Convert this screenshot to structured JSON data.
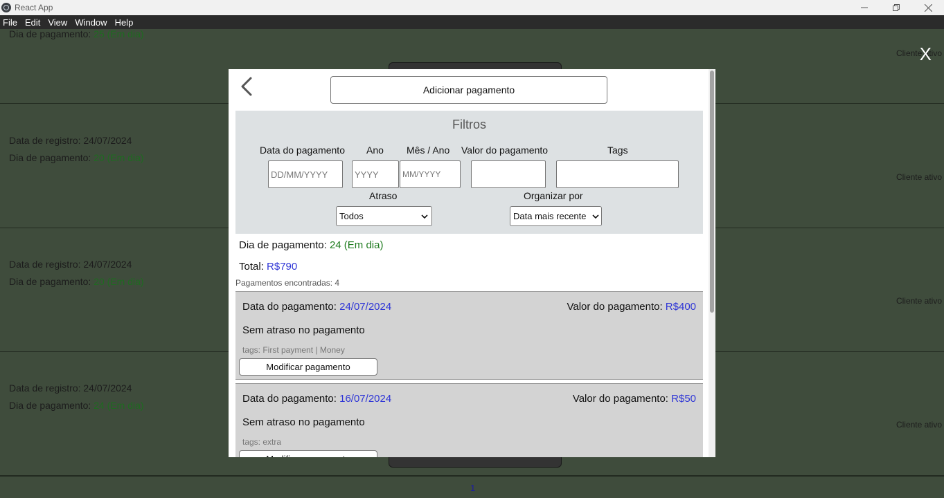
{
  "window": {
    "title": "React App"
  },
  "menu": [
    "File",
    "Edit",
    "View",
    "Window",
    "Help"
  ],
  "background_rows": [
    {
      "registration_label": "",
      "registration_value": "",
      "payment_day_label": "Dia de pagamento:",
      "payment_day_value": "25 (Em dia)",
      "status": "Cliente ativo"
    },
    {
      "registration_label": "Data de registro:",
      "registration_value": "24/07/2024",
      "payment_day_label": "Dia de pagamento:",
      "payment_day_value": "20 (Em dia)",
      "status": "Cliente ativo"
    },
    {
      "registration_label": "Data de registro:",
      "registration_value": "24/07/2024",
      "payment_day_label": "Dia de pagamento:",
      "payment_day_value": "20 (Em dia)",
      "status": "Cliente ativo"
    },
    {
      "registration_label": "Data de registro:",
      "registration_value": "24/07/2024",
      "payment_day_label": "Dia de pagamento:",
      "payment_day_value": "24 (Em dia)",
      "status": "Cliente ativo"
    }
  ],
  "close_label": "X",
  "pagination": {
    "current_page": "1"
  },
  "modal": {
    "add_button_label": "Adicionar pagamento",
    "filters": {
      "title": "Filtros",
      "payment_date_label": "Data do pagamento",
      "payment_date_placeholder": "DD/MM/YYYY",
      "year_label": "Ano",
      "year_placeholder": "YYYY",
      "month_year_label": "Mês / Ano",
      "month_year_placeholder": "MM/YYYY",
      "value_label": "Valor do pagamento",
      "value_value": "",
      "tags_label": "Tags",
      "tags_value": "",
      "delay_label": "Atraso",
      "delay_selected": "Todos",
      "sort_label": "Organizar por",
      "sort_selected": "Data mais recente"
    },
    "summary": {
      "payment_day_label": "Dia de pagamento:",
      "payment_day_value": "24 (Em dia)",
      "total_label": "Total:",
      "total_value": "R$790",
      "found_text": "Pagamentos encontradas: 4"
    },
    "payments": [
      {
        "date_label": "Data do pagamento:",
        "date_value": "24/07/2024",
        "value_label": "Valor do pagamento:",
        "value_value": "R$400",
        "delay_text": "Sem atraso no pagamento",
        "tags_text": "tags: First payment | Money",
        "modify_label": "Modificar pagamento"
      },
      {
        "date_label": "Data do pagamento:",
        "date_value": "16/07/2024",
        "value_label": "Valor do pagamento:",
        "value_value": "R$50",
        "delay_text": "Sem atraso no pagamento",
        "tags_text": "tags: extra",
        "modify_label": "Modificar pagamento"
      }
    ]
  }
}
